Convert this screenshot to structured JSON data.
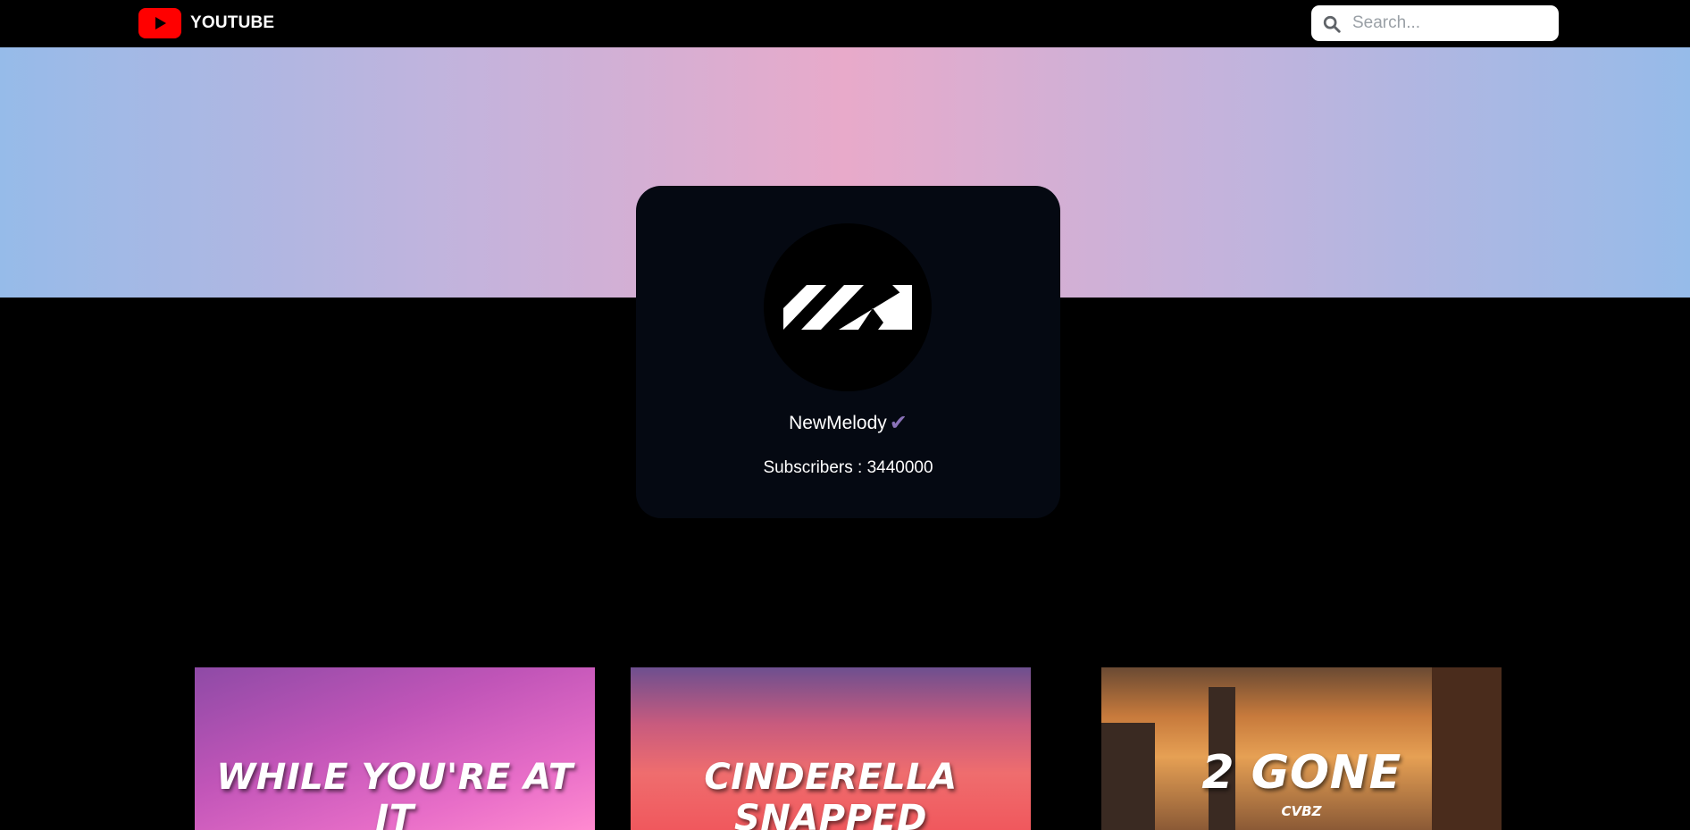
{
  "header": {
    "logo_text": "YOUTUBE",
    "search_placeholder": "Search..."
  },
  "channel": {
    "name": "NewMelody",
    "verified_mark": "✔",
    "subscribers_text": "Subscribers : 3440000"
  },
  "videos": [
    {
      "title": "WHILE YOU'RE AT IT",
      "subtitle": ""
    },
    {
      "title": "CINDERELLA SNAPPED",
      "subtitle": ""
    },
    {
      "title": "2 GONE",
      "subtitle": "CVBZ"
    }
  ],
  "colors": {
    "brand_red": "#ff0000",
    "card_bg": "#050912",
    "verified": "#8a72b8"
  },
  "icons": [
    "youtube-play-icon",
    "search-icon",
    "newmelody-logo-icon",
    "verified-check-icon"
  ]
}
